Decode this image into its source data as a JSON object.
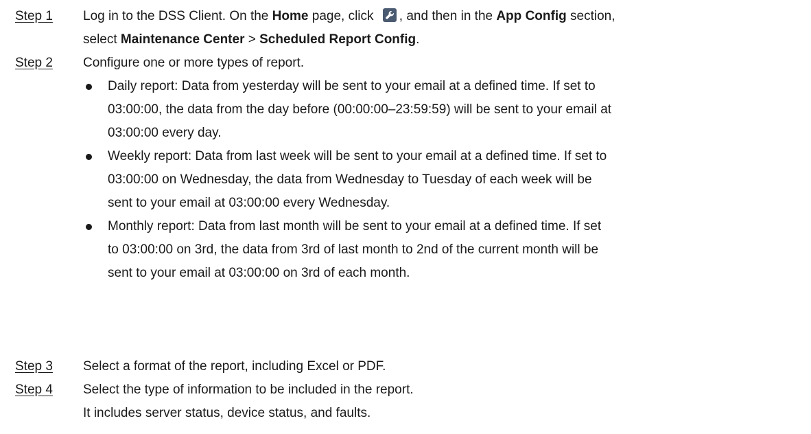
{
  "steps": [
    {
      "label": "Step 1",
      "line1": {
        "pre": "Log in to the DSS Client. On the ",
        "home": "Home",
        "mid": " page, click ",
        "post": ", and then in the ",
        "app_config": "App Config",
        "end": " section,"
      },
      "line2": {
        "pre": "select ",
        "maintenance": "Maintenance Center",
        "sep": " > ",
        "scheduled": "Scheduled Report Config",
        "end": "."
      },
      "icon": "wrench-icon"
    },
    {
      "label": "Step 2",
      "text": "Configure one or more types of report.",
      "bullets": [
        {
          "lines": [
            "Daily report: Data from yesterday will be sent to your email at a defined time. If set to",
            "03:00:00, the data from the day before (00:00:00–23:59:59) will be sent to your email at",
            "03:00:00 every day."
          ]
        },
        {
          "lines": [
            "Weekly report: Data from last week will be sent to your email at a defined time. If set to",
            "03:00:00 on Wednesday, the data from Wednesday to Tuesday of each week will be",
            "sent to your email at 03:00:00 every Wednesday."
          ]
        },
        {
          "lines": [
            "Monthly report: Data from last month will be sent to your email at a defined time. If set",
            "to 03:00:00 on 3rd, the data from 3rd of last month to 2nd of the current month will be",
            "sent to your email at 03:00:00 on 3rd of each month."
          ]
        }
      ]
    },
    {
      "label": "Step 3",
      "text": "Select a format of the report, including Excel or PDF."
    },
    {
      "label": "Step 4",
      "text": "Select the type of information to be included in the report.",
      "text2": "It includes server status, device status, and faults."
    }
  ]
}
